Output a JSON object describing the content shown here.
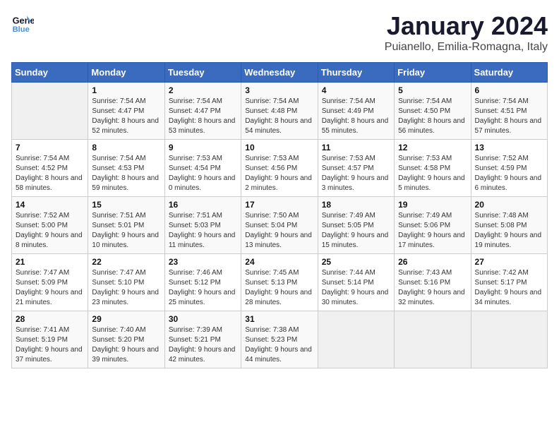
{
  "header": {
    "logo_line1": "General",
    "logo_line2": "Blue",
    "month_title": "January 2024",
    "subtitle": "Puianello, Emilia-Romagna, Italy"
  },
  "weekdays": [
    "Sunday",
    "Monday",
    "Tuesday",
    "Wednesday",
    "Thursday",
    "Friday",
    "Saturday"
  ],
  "weeks": [
    [
      {
        "day": "",
        "sunrise": "",
        "sunset": "",
        "daylight": ""
      },
      {
        "day": "1",
        "sunrise": "Sunrise: 7:54 AM",
        "sunset": "Sunset: 4:47 PM",
        "daylight": "Daylight: 8 hours and 52 minutes."
      },
      {
        "day": "2",
        "sunrise": "Sunrise: 7:54 AM",
        "sunset": "Sunset: 4:47 PM",
        "daylight": "Daylight: 8 hours and 53 minutes."
      },
      {
        "day": "3",
        "sunrise": "Sunrise: 7:54 AM",
        "sunset": "Sunset: 4:48 PM",
        "daylight": "Daylight: 8 hours and 54 minutes."
      },
      {
        "day": "4",
        "sunrise": "Sunrise: 7:54 AM",
        "sunset": "Sunset: 4:49 PM",
        "daylight": "Daylight: 8 hours and 55 minutes."
      },
      {
        "day": "5",
        "sunrise": "Sunrise: 7:54 AM",
        "sunset": "Sunset: 4:50 PM",
        "daylight": "Daylight: 8 hours and 56 minutes."
      },
      {
        "day": "6",
        "sunrise": "Sunrise: 7:54 AM",
        "sunset": "Sunset: 4:51 PM",
        "daylight": "Daylight: 8 hours and 57 minutes."
      }
    ],
    [
      {
        "day": "7",
        "sunrise": "Sunrise: 7:54 AM",
        "sunset": "Sunset: 4:52 PM",
        "daylight": "Daylight: 8 hours and 58 minutes."
      },
      {
        "day": "8",
        "sunrise": "Sunrise: 7:54 AM",
        "sunset": "Sunset: 4:53 PM",
        "daylight": "Daylight: 8 hours and 59 minutes."
      },
      {
        "day": "9",
        "sunrise": "Sunrise: 7:53 AM",
        "sunset": "Sunset: 4:54 PM",
        "daylight": "Daylight: 9 hours and 0 minutes."
      },
      {
        "day": "10",
        "sunrise": "Sunrise: 7:53 AM",
        "sunset": "Sunset: 4:56 PM",
        "daylight": "Daylight: 9 hours and 2 minutes."
      },
      {
        "day": "11",
        "sunrise": "Sunrise: 7:53 AM",
        "sunset": "Sunset: 4:57 PM",
        "daylight": "Daylight: 9 hours and 3 minutes."
      },
      {
        "day": "12",
        "sunrise": "Sunrise: 7:53 AM",
        "sunset": "Sunset: 4:58 PM",
        "daylight": "Daylight: 9 hours and 5 minutes."
      },
      {
        "day": "13",
        "sunrise": "Sunrise: 7:52 AM",
        "sunset": "Sunset: 4:59 PM",
        "daylight": "Daylight: 9 hours and 6 minutes."
      }
    ],
    [
      {
        "day": "14",
        "sunrise": "Sunrise: 7:52 AM",
        "sunset": "Sunset: 5:00 PM",
        "daylight": "Daylight: 9 hours and 8 minutes."
      },
      {
        "day": "15",
        "sunrise": "Sunrise: 7:51 AM",
        "sunset": "Sunset: 5:01 PM",
        "daylight": "Daylight: 9 hours and 10 minutes."
      },
      {
        "day": "16",
        "sunrise": "Sunrise: 7:51 AM",
        "sunset": "Sunset: 5:03 PM",
        "daylight": "Daylight: 9 hours and 11 minutes."
      },
      {
        "day": "17",
        "sunrise": "Sunrise: 7:50 AM",
        "sunset": "Sunset: 5:04 PM",
        "daylight": "Daylight: 9 hours and 13 minutes."
      },
      {
        "day": "18",
        "sunrise": "Sunrise: 7:49 AM",
        "sunset": "Sunset: 5:05 PM",
        "daylight": "Daylight: 9 hours and 15 minutes."
      },
      {
        "day": "19",
        "sunrise": "Sunrise: 7:49 AM",
        "sunset": "Sunset: 5:06 PM",
        "daylight": "Daylight: 9 hours and 17 minutes."
      },
      {
        "day": "20",
        "sunrise": "Sunrise: 7:48 AM",
        "sunset": "Sunset: 5:08 PM",
        "daylight": "Daylight: 9 hours and 19 minutes."
      }
    ],
    [
      {
        "day": "21",
        "sunrise": "Sunrise: 7:47 AM",
        "sunset": "Sunset: 5:09 PM",
        "daylight": "Daylight: 9 hours and 21 minutes."
      },
      {
        "day": "22",
        "sunrise": "Sunrise: 7:47 AM",
        "sunset": "Sunset: 5:10 PM",
        "daylight": "Daylight: 9 hours and 23 minutes."
      },
      {
        "day": "23",
        "sunrise": "Sunrise: 7:46 AM",
        "sunset": "Sunset: 5:12 PM",
        "daylight": "Daylight: 9 hours and 25 minutes."
      },
      {
        "day": "24",
        "sunrise": "Sunrise: 7:45 AM",
        "sunset": "Sunset: 5:13 PM",
        "daylight": "Daylight: 9 hours and 28 minutes."
      },
      {
        "day": "25",
        "sunrise": "Sunrise: 7:44 AM",
        "sunset": "Sunset: 5:14 PM",
        "daylight": "Daylight: 9 hours and 30 minutes."
      },
      {
        "day": "26",
        "sunrise": "Sunrise: 7:43 AM",
        "sunset": "Sunset: 5:16 PM",
        "daylight": "Daylight: 9 hours and 32 minutes."
      },
      {
        "day": "27",
        "sunrise": "Sunrise: 7:42 AM",
        "sunset": "Sunset: 5:17 PM",
        "daylight": "Daylight: 9 hours and 34 minutes."
      }
    ],
    [
      {
        "day": "28",
        "sunrise": "Sunrise: 7:41 AM",
        "sunset": "Sunset: 5:19 PM",
        "daylight": "Daylight: 9 hours and 37 minutes."
      },
      {
        "day": "29",
        "sunrise": "Sunrise: 7:40 AM",
        "sunset": "Sunset: 5:20 PM",
        "daylight": "Daylight: 9 hours and 39 minutes."
      },
      {
        "day": "30",
        "sunrise": "Sunrise: 7:39 AM",
        "sunset": "Sunset: 5:21 PM",
        "daylight": "Daylight: 9 hours and 42 minutes."
      },
      {
        "day": "31",
        "sunrise": "Sunrise: 7:38 AM",
        "sunset": "Sunset: 5:23 PM",
        "daylight": "Daylight: 9 hours and 44 minutes."
      },
      {
        "day": "",
        "sunrise": "",
        "sunset": "",
        "daylight": ""
      },
      {
        "day": "",
        "sunrise": "",
        "sunset": "",
        "daylight": ""
      },
      {
        "day": "",
        "sunrise": "",
        "sunset": "",
        "daylight": ""
      }
    ]
  ]
}
